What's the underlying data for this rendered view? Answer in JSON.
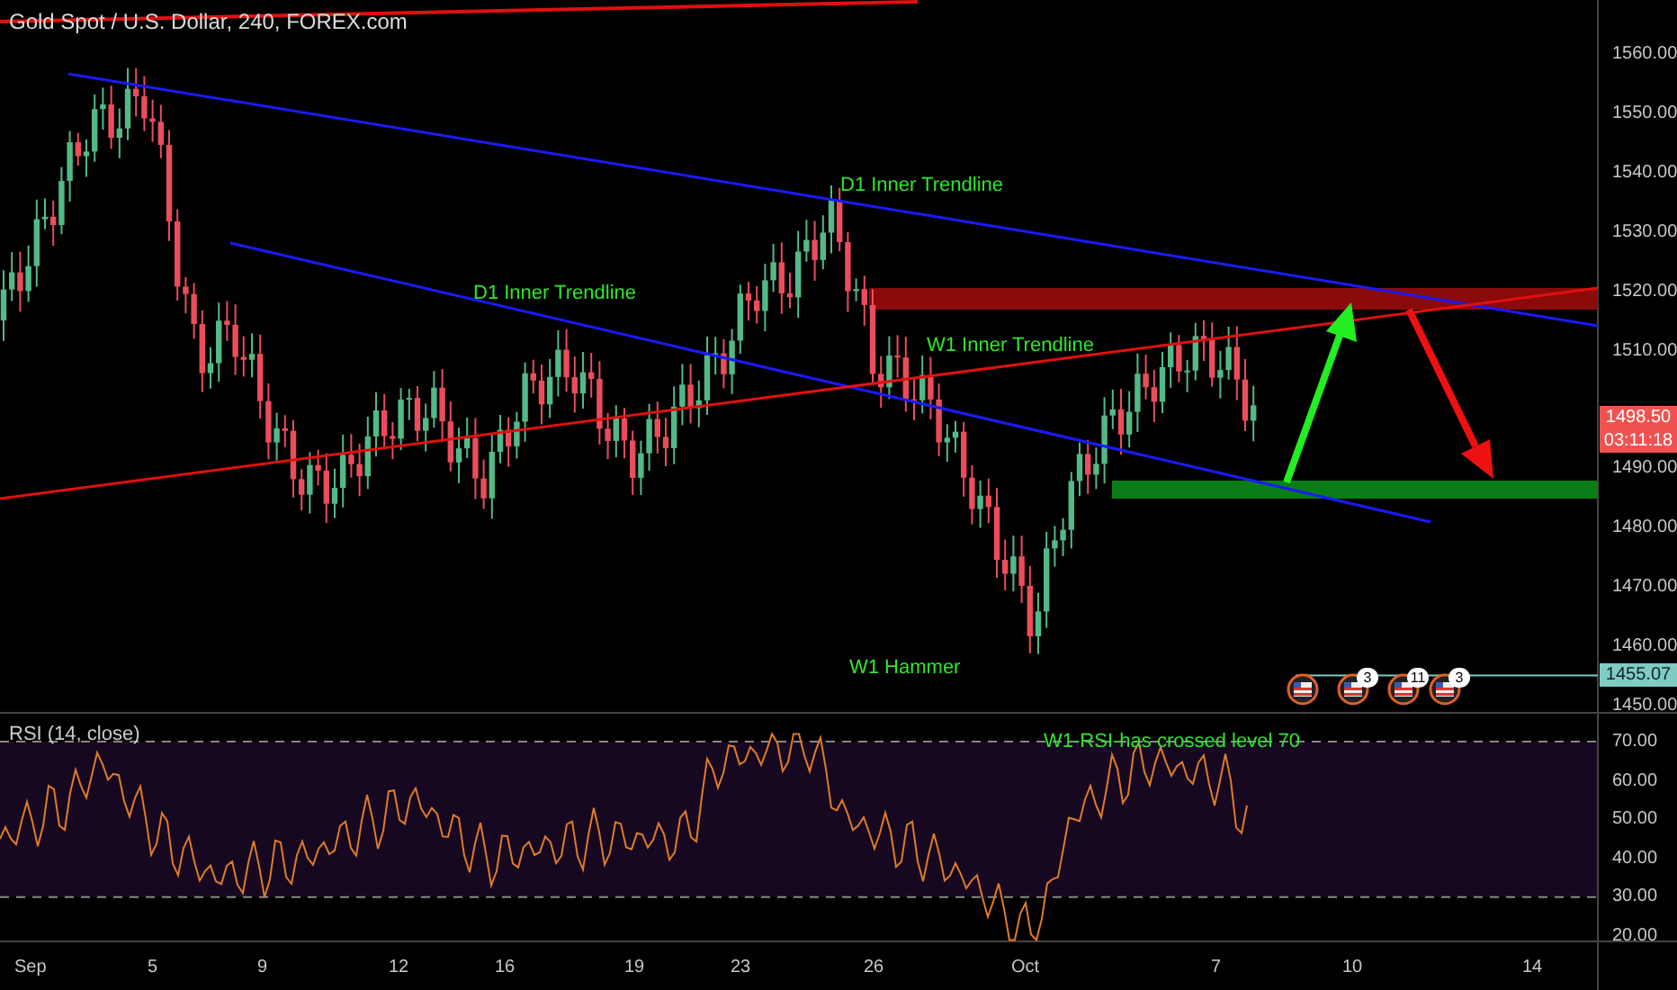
{
  "header": {
    "title": "Gold Spot / U.S. Dollar, 240, FOREX.com"
  },
  "annotations": [
    {
      "text": "D1 Inner Trendline"
    },
    {
      "text": "D1 Inner Trendline"
    },
    {
      "text": "W1 Inner Trendline"
    },
    {
      "text": "W1 Hammer"
    },
    {
      "text": "W1-RSI-has crossed level 70"
    }
  ],
  "price_axis": {
    "ticks": [
      "1560.00",
      "1550.00",
      "1540.00",
      "1530.00",
      "1520.00",
      "1510.00",
      "1490.00",
      "1480.00",
      "1470.00",
      "1460.00",
      "1450.00"
    ],
    "last_price": "1498.50",
    "countdown": "03:11:18",
    "marker_price": "1455.07"
  },
  "events": [
    {
      "kind": "plain"
    },
    {
      "kind": "counted",
      "count": "3"
    },
    {
      "kind": "counted",
      "count": "11"
    },
    {
      "kind": "counted",
      "count": "3"
    }
  ],
  "rsi": {
    "label": "RSI (14, close)",
    "ticks": [
      "70.00",
      "60.00",
      "50.00",
      "40.00",
      "30.00",
      "20.00"
    ]
  },
  "time_axis": {
    "ticks": [
      "Sep",
      "5",
      "9",
      "12",
      "16",
      "19",
      "23",
      "26",
      "Oct",
      "7",
      "10",
      "14"
    ]
  }
}
